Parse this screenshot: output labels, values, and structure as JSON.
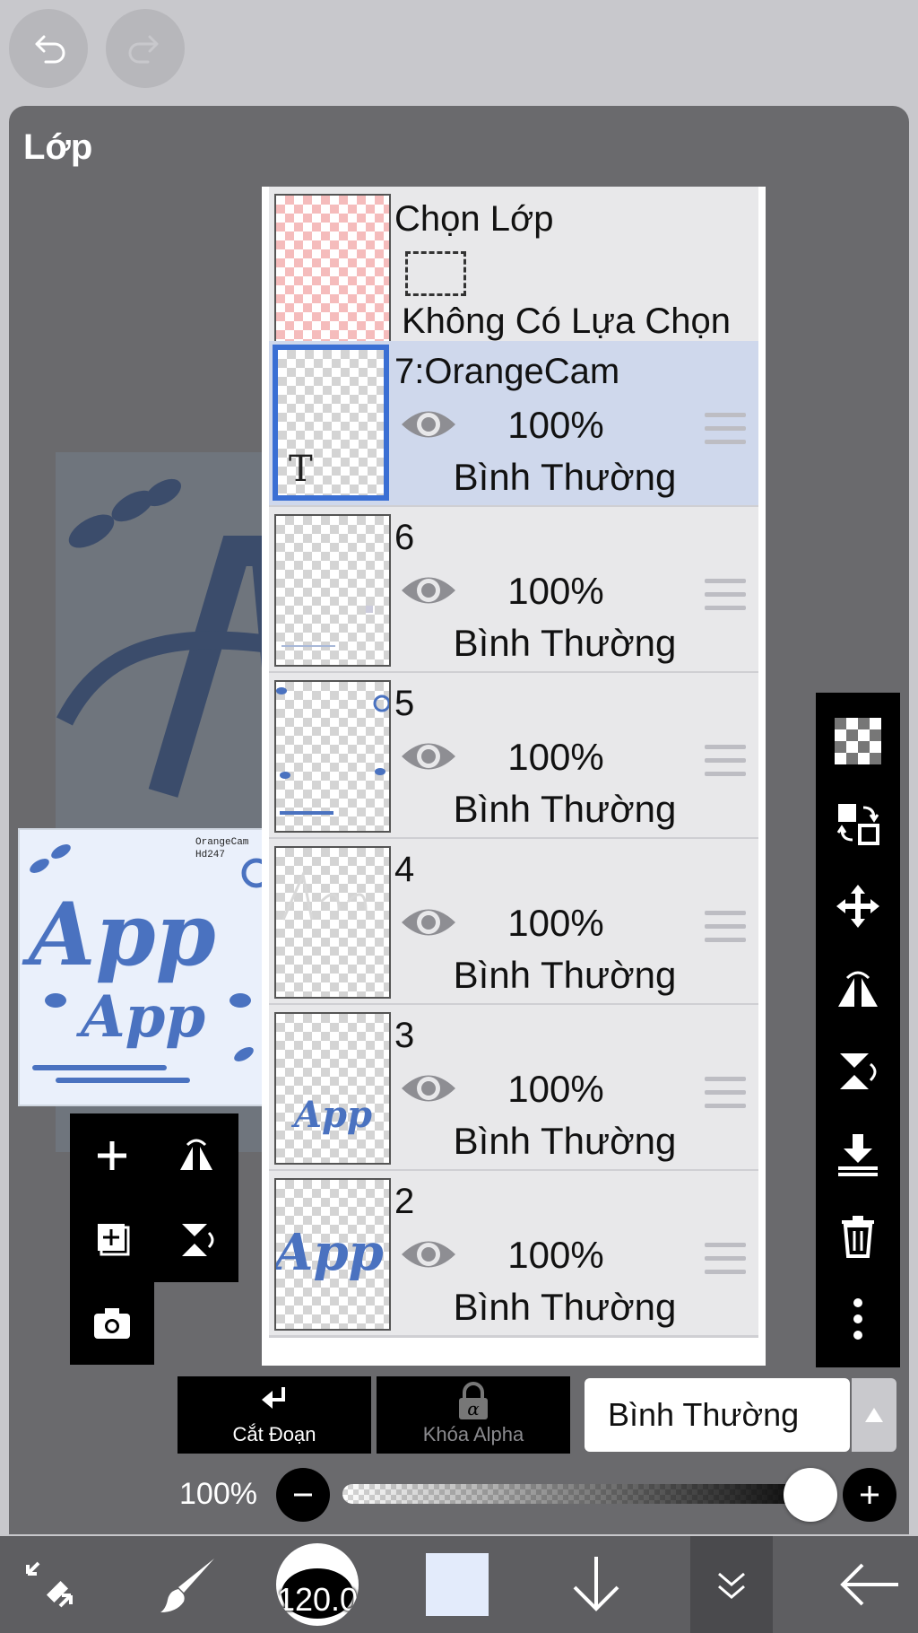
{
  "header": {
    "undo_icon": "undo-icon",
    "redo_icon": "redo-icon"
  },
  "panel": {
    "title": "Lớp"
  },
  "preview": {
    "text_small_1": "OrangeCam",
    "text_small_2": "Hd247",
    "art_text_1": "App",
    "art_text_2": "App"
  },
  "selection_layer": {
    "title": "Chọn Lớp",
    "subtitle": "Không Có Lựa Chọn"
  },
  "layers": [
    {
      "name": "7:OrangeCam",
      "opacity": "100%",
      "blend": "Bình Thường",
      "selected": true,
      "thumb_text": "T"
    },
    {
      "name": "6",
      "opacity": "100%",
      "blend": "Bình Thường",
      "selected": false
    },
    {
      "name": "5",
      "opacity": "100%",
      "blend": "Bình Thường",
      "selected": false
    },
    {
      "name": "4",
      "opacity": "100%",
      "blend": "Bình Thường",
      "selected": false
    },
    {
      "name": "3",
      "opacity": "100%",
      "blend": "Bình Thường",
      "selected": false
    },
    {
      "name": "2",
      "opacity": "100%",
      "blend": "Bình Thường",
      "selected": false
    }
  ],
  "bottom": {
    "clip_label": "Cắt Đoạn",
    "alpha_label": "Khóa Alpha",
    "blend_mode": "Bình Thường",
    "opacity_label": "100%",
    "opacity_value": 1.0
  },
  "toolbar": {
    "brush_size": "120.0",
    "current_color": "#e3ebfb"
  },
  "colors": {
    "accent": "#3a6fd4",
    "selected_row": "#cfd8ec",
    "art_blue": "#4a72c0"
  }
}
